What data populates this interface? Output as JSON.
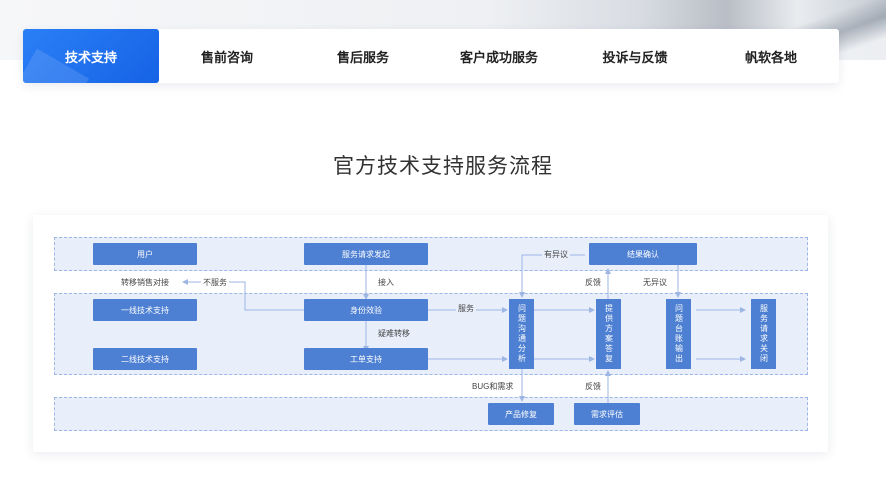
{
  "tabs": [
    {
      "label": "技术支持"
    },
    {
      "label": "售前咨询"
    },
    {
      "label": "售后服务"
    },
    {
      "label": "客户成功服务"
    },
    {
      "label": "投诉与反馈"
    },
    {
      "label": "帆软各地"
    }
  ],
  "section_title": "官方技术支持服务流程",
  "flow": {
    "nodes": {
      "user": "用户",
      "first_line": "一线技术支持",
      "second_line": "二线技术支持",
      "request": "服务请求发起",
      "identity": "身份效验",
      "ticket": "工单支持",
      "analysis": "问题沟通分析",
      "solution": "提供方案答复",
      "ledger": "问题台账输出",
      "close": "服务请求关闭",
      "confirm": "结果确认",
      "fix": "产品修复",
      "eval": "需求评估"
    },
    "labels": {
      "transfer_sales": "转移销售对接",
      "no_service": "不服务",
      "access": "接入",
      "service": "服务",
      "escalate": "疑难转移",
      "objection": "有异议",
      "feedback_top": "反馈",
      "no_objection": "无异议",
      "bug_request": "BUG和需求",
      "feedback_bottom": "反馈"
    }
  },
  "colors": {
    "accent": "#1a6cf0",
    "node": "#4d7fd2",
    "lane": "#e8effb",
    "arrow": "#9db6e4"
  }
}
